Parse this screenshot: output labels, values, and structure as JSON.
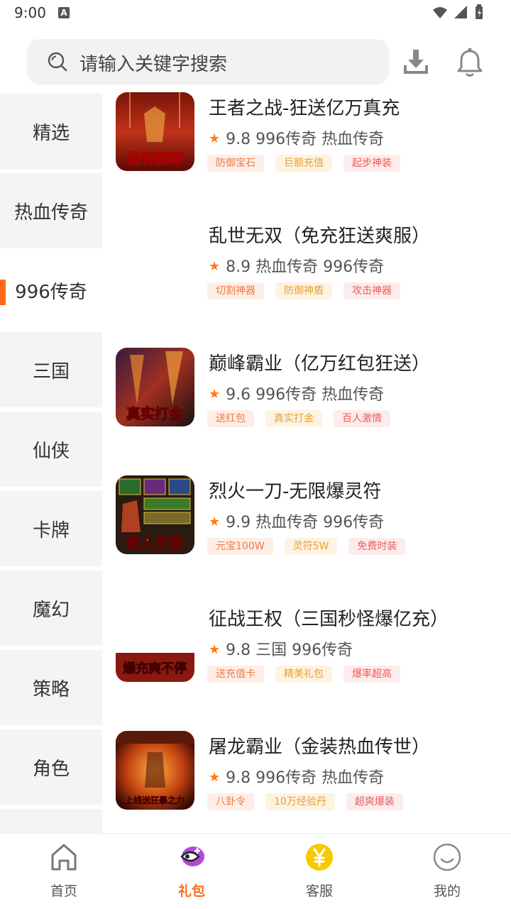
{
  "status": {
    "time": "9:00",
    "a_badge": "A"
  },
  "search": {
    "placeholder": "请输入关键字搜索"
  },
  "sidebar": {
    "items": [
      {
        "label": "精选"
      },
      {
        "label": "热血传奇"
      },
      {
        "label": "996传奇"
      },
      {
        "label": "三国"
      },
      {
        "label": "仙侠"
      },
      {
        "label": "卡牌"
      },
      {
        "label": "魔幻"
      },
      {
        "label": "策略"
      },
      {
        "label": "角色"
      }
    ],
    "active_index": 2
  },
  "games": [
    {
      "title": "王者之战-狂送亿万真充",
      "rating": "9.8",
      "cats": "996传奇 热血传奇",
      "tags": [
        "防御宝石",
        "巨额充值",
        "起步神装"
      ],
      "thumb_text": "没有就卸"
    },
    {
      "title": "乱世无双（免充狂送爽服）",
      "rating": "8.9",
      "cats": "热血传奇 996传奇",
      "tags": [
        "切割神器",
        "防御神盾",
        "攻击神器"
      ],
      "thumb_text": ""
    },
    {
      "title": "巅峰霸业（亿万红包狂送）",
      "rating": "9.6",
      "cats": "996传奇 热血传奇",
      "tags": [
        "送红包",
        "真实打金",
        "百人激情"
      ],
      "thumb_text": "真实打金"
    },
    {
      "title": "烈火一刀-无限爆灵符",
      "rating": "9.9",
      "cats": "热血传奇 996传奇",
      "tags": [
        "元宝100W",
        "灵符5W",
        "免费时装"
      ],
      "thumb_text": "散人天堂"
    },
    {
      "title": "征战王权（三国秒怪爆亿充）",
      "rating": "9.8",
      "cats": "三国 996传奇",
      "tags": [
        "送充值卡",
        "精美礼包",
        "爆率超高"
      ],
      "thumb_text": "爆充爽不停"
    },
    {
      "title": "屠龙霸业（金装热血传世）",
      "rating": "9.8",
      "cats": "996传奇 热血传奇",
      "tags": [
        "八卦令",
        "10万经验丹",
        "超爽爆装"
      ],
      "thumb_text": "上线送狂暴之力"
    }
  ],
  "nav": {
    "items": [
      {
        "label": "首页",
        "icon": "home-icon"
      },
      {
        "label": "礼包",
        "icon": "gift-icon"
      },
      {
        "label": "客服",
        "icon": "yuan-icon"
      },
      {
        "label": "我的",
        "icon": "smile-icon"
      }
    ],
    "active_index": 1
  },
  "colors": {
    "accent": "#ff6a1a",
    "star": "#ff7a18"
  }
}
